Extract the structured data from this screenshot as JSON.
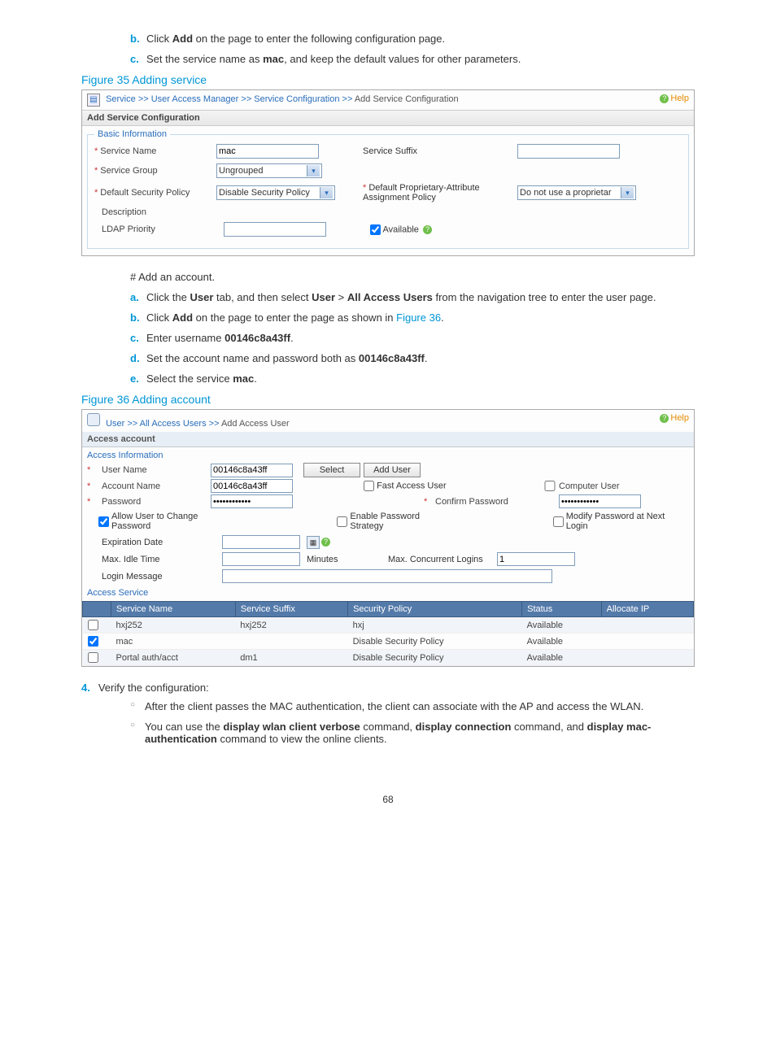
{
  "steps_b": "Click Add on the page to enter the following configuration page.",
  "steps_c": "Set the service name as mac, and keep the default values for other parameters.",
  "fig35_title": "Figure 35 Adding service",
  "fig35": {
    "trail": {
      "a": "Service",
      "b": "User Access Manager",
      "c": "Service Configuration",
      "d": "Add Service Configuration"
    },
    "help": "Help",
    "bar": "Add Service Configuration",
    "legend": "Basic Information",
    "rows": {
      "service_name_lbl": "Service Name",
      "service_name_val": "mac",
      "service_suffix_lbl": "Service Suffix",
      "service_group_lbl": "Service Group",
      "service_group_val": "Ungrouped",
      "def_sec_pol_lbl": "Default Security Policy",
      "def_sec_pol_val": "Disable Security Policy",
      "def_prop_lbl": "Default Proprietary-Attribute Assignment Policy",
      "def_prop_val": "Do not use a proprietar",
      "desc_lbl": "Description",
      "ldap_lbl": "LDAP Priority",
      "available_lbl": "Available"
    }
  },
  "add_account_hdr": "# Add an account.",
  "acct_a": "Click the User tab, and then select User > All Access Users from the navigation tree to enter the user page.",
  "acct_b_pre": "Click Add on the page to enter the page as shown in ",
  "acct_b_link": "Figure 36",
  "acct_b_post": ".",
  "acct_c": "Enter username 00146c8a43ff.",
  "acct_d": "Set the account name and password both as 00146c8a43ff.",
  "acct_e": "Select the service mac.",
  "fig36_title": "Figure 36 Adding account",
  "fig36": {
    "trail": {
      "a": "User",
      "b": "All Access Users",
      "c": "Add Access User"
    },
    "help": "Help",
    "bar": "Access account",
    "sub1": "Access Information",
    "user_name_lbl": "User Name",
    "user_name_val": "00146c8a43ff",
    "select_btn": "Select",
    "adduser_btn": "Add User",
    "account_name_lbl": "Account Name",
    "account_name_val": "00146c8a43ff",
    "fast_user_lbl": "Fast Access User",
    "computer_user_lbl": "Computer User",
    "password_lbl": "Password",
    "password_val": "••••••••••••",
    "confirm_lbl": "Confirm Password",
    "confirm_val": "••••••••••••",
    "allow_change_lbl": "Allow User to Change Password",
    "enable_strat_lbl": "Enable Password Strategy",
    "modify_next_lbl": "Modify Password at Next Login",
    "expiration_lbl": "Expiration Date",
    "max_idle_lbl": "Max. Idle Time",
    "minutes_lbl": "Minutes",
    "max_conc_lbl": "Max. Concurrent Logins",
    "max_conc_val": "1",
    "login_msg_lbl": "Login Message",
    "sub2": "Access Service",
    "table": {
      "hdr": {
        "c0": "",
        "c1": "Service Name",
        "c2": "Service Suffix",
        "c3": "Security Policy",
        "c4": "Status",
        "c5": "Allocate IP"
      },
      "rows": [
        {
          "chk": false,
          "name": "hxj252",
          "suffix": "hxj252",
          "policy": "hxj",
          "status": "Available",
          "alloc": ""
        },
        {
          "chk": true,
          "name": "mac",
          "suffix": "",
          "policy": "Disable Security Policy",
          "status": "Available",
          "alloc": ""
        },
        {
          "chk": false,
          "name": "Portal auth/acct",
          "suffix": "dm1",
          "policy": "Disable Security Policy",
          "status": "Available",
          "alloc": ""
        }
      ]
    }
  },
  "step4_num": "4.",
  "step4_txt": "Verify the configuration:",
  "verify_a": "After the client passes the MAC authentication, the client can associate with the AP and access the WLAN.",
  "verify_b": "You can use the display wlan client verbose command, display connection command, and display mac-authentication command to view the online clients.",
  "pagenum": "68"
}
